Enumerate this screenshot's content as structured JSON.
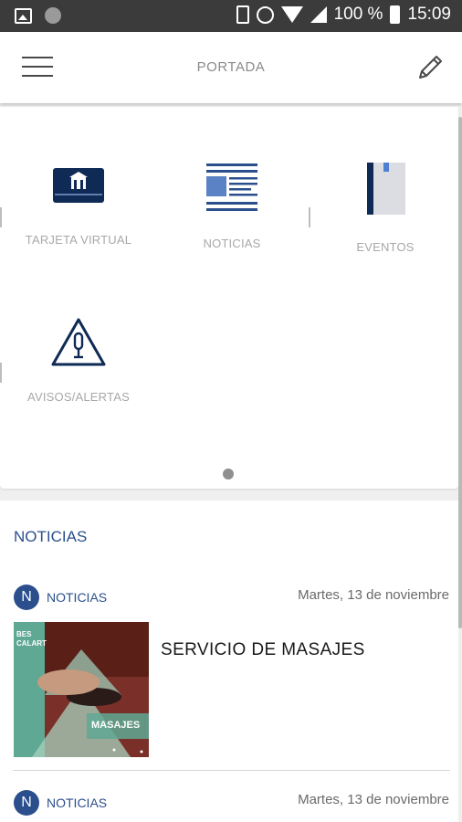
{
  "status_bar": {
    "battery": "100 %",
    "time": "15:09"
  },
  "app_bar": {
    "title": "PORTADA",
    "menu_icon": "menu-icon",
    "edit_icon": "pencil-icon"
  },
  "grid": {
    "tiles": [
      {
        "label": "TARJETA VIRTUAL",
        "icon": "virtual-card-icon"
      },
      {
        "label": "NOTICIAS",
        "icon": "news-icon"
      },
      {
        "label": "EVENTOS",
        "icon": "events-book-icon"
      },
      {
        "label": "AVISOS/ALERTAS",
        "icon": "alert-icon"
      }
    ],
    "pager_pages": 1
  },
  "news": {
    "heading": "NOTICIAS",
    "items": [
      {
        "badge": "N",
        "category": "NOTICIAS",
        "date": "Martes, 13 de noviembre",
        "title": "SERVICIO DE MASAJES",
        "thumb_text_1": "BES",
        "thumb_text_2": "CALART",
        "thumb_text_3": "MASAJES"
      },
      {
        "badge": "N",
        "category": "NOTICIAS",
        "date": "Martes, 13 de noviembre"
      }
    ]
  },
  "colors": {
    "brand_blue": "#2b4f8c",
    "card_navy": "#0f2a55",
    "status_bar": "#3b3b3b"
  }
}
